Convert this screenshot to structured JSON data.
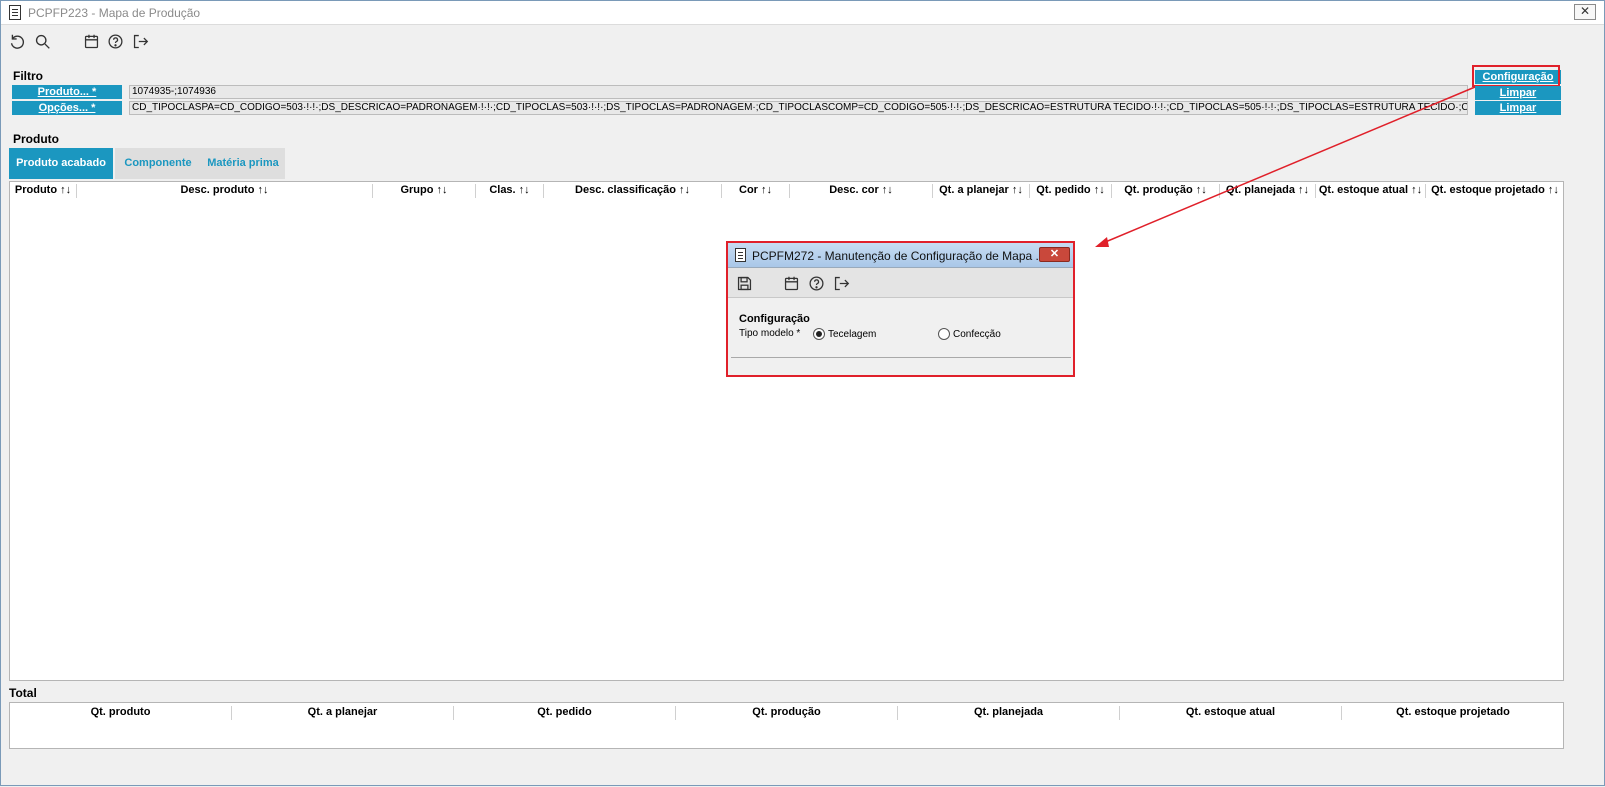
{
  "window": {
    "title": "PCPFP223 - Mapa de Produção",
    "close_symbol": "✕"
  },
  "toolbar": {
    "icons": [
      "undo-icon",
      "search-icon",
      "calendar-icon",
      "help-icon",
      "exit-icon"
    ]
  },
  "filter": {
    "section_label": "Filtro",
    "produto_label": "Produto... *",
    "produto_value": "1074935-;1074936",
    "opcoes_label": "Opções... *",
    "opcoes_value": "CD_TIPOCLASPA=CD_CODIGO=503·!·!·;DS_DESCRICAO=PADRONAGEM·!·!·;CD_TIPOCLAS=503·!·!·;DS_TIPOCLAS=PADRONAGEM·;CD_TIPOCLASCOMP=CD_CODIGO=505·!·!·;DS_DESCRICAO=ESTRUTURA TECIDO·!·!·;CD_TIPOCLAS=505·!·!·;DS_TIPOCLAS=ESTRUTURA TECIDO·;CD_TIPOCLASCOMP",
    "configuracao_button": "Configuração",
    "limpar_produto_button": "Limpar",
    "limpar_opcoes_button": "Limpar"
  },
  "produto": {
    "section_label": "Produto",
    "tabs": [
      {
        "label": "Produto acabado",
        "active": true
      },
      {
        "label": "Componente",
        "active": false
      },
      {
        "label": "Matéria prima",
        "active": false
      }
    ],
    "columns": [
      "Produto ↑↓",
      "Desc. produto ↑↓",
      "Grupo ↑↓",
      "Clas. ↑↓",
      "Desc. classificação ↑↓",
      "Cor ↑↓",
      "Desc. cor ↑↓",
      "Qt. a planejar ↑↓",
      "Qt. pedido ↑↓",
      "Qt. produção ↑↓",
      "Qt. planejada ↑↓",
      "Qt. estoque atual ↑↓",
      "Qt. estoque projetado ↑↓"
    ]
  },
  "total": {
    "section_label": "Total",
    "columns": [
      "Qt. produto",
      "Qt. a planejar",
      "Qt. pedido",
      "Qt. produção",
      "Qt. planejada",
      "Qt. estoque atual",
      "Qt. estoque projetado"
    ]
  },
  "dialog": {
    "title": "PCPFM272 - Manutenção de Configuração de Mapa ...",
    "close_symbol": "✕",
    "toolbar_icons": [
      "save-icon",
      "calendar-icon",
      "help-icon",
      "exit-icon"
    ],
    "section_label": "Configuração",
    "field_label": "Tipo modelo *",
    "options": [
      {
        "label": "Tecelagem",
        "selected": true
      },
      {
        "label": "Confecção",
        "selected": false
      }
    ]
  },
  "colors": {
    "accent": "#1b97c0",
    "highlight": "#e0202a"
  }
}
